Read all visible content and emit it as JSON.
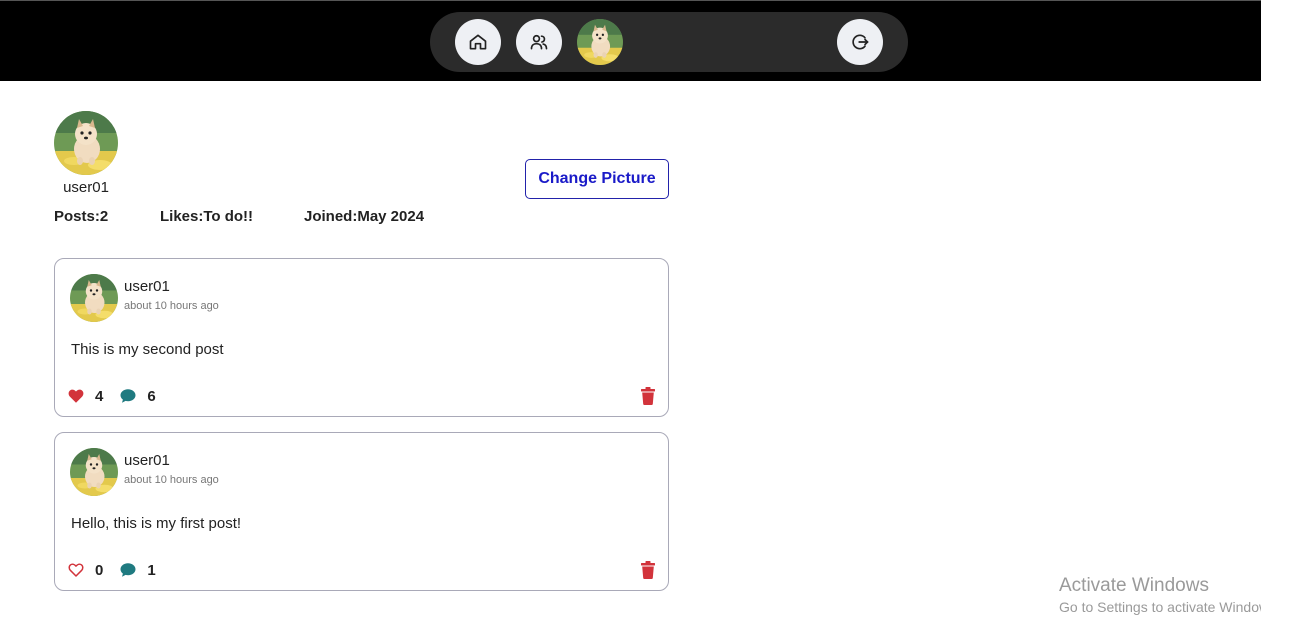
{
  "nav": {
    "icons": [
      "home-icon",
      "users-icon",
      "avatar",
      "logout-icon"
    ]
  },
  "profile": {
    "username": "user01",
    "posts_stat": "Posts:2",
    "likes_stat": "Likes:To do!!",
    "joined_stat": "Joined:May 2024",
    "change_picture_label": "Change Picture"
  },
  "posts": [
    {
      "author": "user01",
      "time": "about 10 hours ago",
      "text": "This is my second post",
      "likes": "4",
      "comments": "6",
      "liked": true
    },
    {
      "author": "user01",
      "time": "about 10 hours ago",
      "text": "Hello, this is my first post!",
      "likes": "0",
      "comments": "1",
      "liked": false
    }
  ],
  "colors": {
    "heart": "#d2333b",
    "comment": "#1f7a80",
    "trash": "#d2333b",
    "button_text": "#1a1ac8"
  },
  "watermark": {
    "title": "Activate Windows",
    "subtitle": "Go to Settings to activate Windows."
  }
}
